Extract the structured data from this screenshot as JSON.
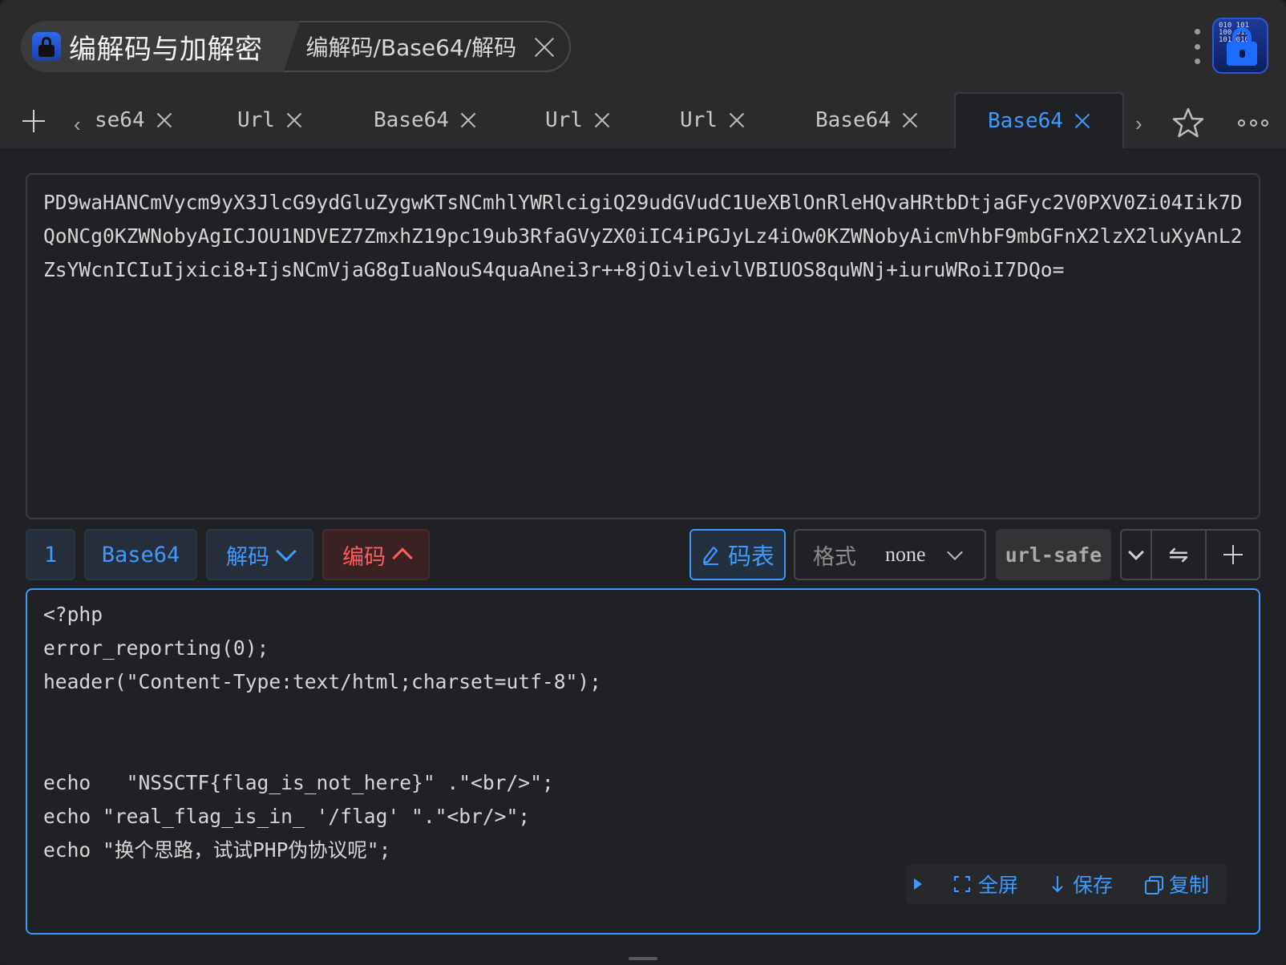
{
  "breadcrumb": {
    "app_label": "编解码与加解密",
    "path_label": "编解码/Base64/解码"
  },
  "tabs": [
    {
      "label": "se64",
      "active": false
    },
    {
      "label": "Url",
      "active": false
    },
    {
      "label": "Base64",
      "active": false
    },
    {
      "label": "Url",
      "active": false
    },
    {
      "label": "Url",
      "active": false
    },
    {
      "label": "Base64",
      "active": false
    },
    {
      "label": "Base64",
      "active": true
    }
  ],
  "input": {
    "text": "PD9waHANCmVycm9yX3JlcG9ydGluZygwKTsNCmhlYWRlcigiQ29udGVudC1UeXBlOnRleHQvaHRtbDtjaGFyc2V0PXV0Zi04Iik7DQoNCg0KZWNobyAgICJOU1NDVEZ7ZmxhZ19pc19ub3RfaGVyZX0iIC4iPGJyLz4iOw0KZWNobyAicmVhbF9mbGFnX2lzX2luXyAnL2ZsYWcnICIuIjxici8+IjsNCmVjaG8gIuaNouS4quaAnei3r++8jOivleivlVBIUOS8quWNj+iuruWRoiI7DQo="
  },
  "toolbar": {
    "step": "1",
    "algorithm": "Base64",
    "decode_label": "解码",
    "encode_label": "编码",
    "code_table_label": "码表",
    "format_label": "格式",
    "format_value": "none",
    "url_safe_label": "url-safe",
    "swap_glyph": "⇋"
  },
  "output": {
    "text": "<?php\nerror_reporting(0);\nheader(\"Content-Type:text/html;charset=utf-8\");\n\n\necho   \"NSSCTF{flag_is_not_here}\" .\"<br/>\";\necho \"real_flag_is_in_ '/flag' \".\"<br/>\";\necho \"换个思路，试试PHP伪协议呢\";"
  },
  "output_actions": {
    "fullscreen_label": "全屏",
    "save_label": "保存",
    "copy_label": "复制"
  },
  "colors": {
    "accent": "#3d9bff",
    "encode_red": "#ff5d5d",
    "background": "#1f2124",
    "titlebar": "#2b2b2d"
  }
}
